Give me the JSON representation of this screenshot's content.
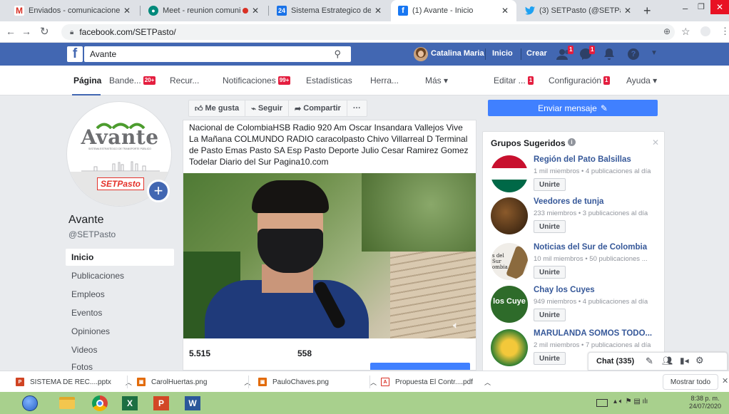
{
  "browser": {
    "tabs": [
      {
        "title": "Enviados - comunicaciones@av",
        "icon": "gmail-icon"
      },
      {
        "title": "Meet - reunion comunicac",
        "icon": "meet-icon"
      },
      {
        "title": "Sistema Estrategico de Transpor",
        "icon": "calendar-icon"
      },
      {
        "title": "(1) Avante - Inicio",
        "icon": "facebook-icon"
      },
      {
        "title": "(3) SETPasto (@SETPasto) / Twit",
        "icon": "twitter-icon"
      }
    ],
    "new_tab": "+",
    "url": "facebook.com/SETPasto/"
  },
  "fb_header": {
    "logo": "f",
    "search_value": "Avante",
    "user_name": "Catalina Maria",
    "nav": {
      "home": "Inicio",
      "create": "Crear"
    },
    "badges": {
      "friends": "1",
      "messages": "1"
    }
  },
  "subnav": {
    "items": [
      {
        "label": "Página",
        "active": true
      },
      {
        "label": "Bande...",
        "badge": "20+"
      },
      {
        "label": "Recur..."
      },
      {
        "label": "Notificaciones",
        "badge": "99+"
      },
      {
        "label": "Estadísticas"
      },
      {
        "label": "Herra..."
      },
      {
        "label": "Más ▾"
      },
      {
        "label": "Editar ...",
        "badge": "1"
      },
      {
        "label": "Configuración",
        "badge": "1"
      },
      {
        "label": "Ayuda ▾"
      }
    ]
  },
  "page": {
    "name": "Avante",
    "handle": "@SETPasto",
    "logo_text": "Avante",
    "logo_subtext": "SISTEMA ESTRATÉGICO DE TRANSPORTE PÚBLICO",
    "logo_tag": "SETPasto"
  },
  "sidebar": {
    "items": [
      {
        "label": "Inicio",
        "active": true
      },
      {
        "label": "Publicaciones"
      },
      {
        "label": "Empleos"
      },
      {
        "label": "Eventos"
      },
      {
        "label": "Opiniones"
      },
      {
        "label": "Videos"
      },
      {
        "label": "Fotos"
      }
    ]
  },
  "actions": {
    "like": "Me gusta",
    "follow": "Seguir",
    "share": "Compartir",
    "more": "···",
    "send_message": "Enviar mensaje"
  },
  "post": {
    "text": "Nacional de ColombiaHSB Radio 920 Am Oscar Insandara Vallejos Vive La Mañana COLMUNDO RADIO caracolpasto Chivo Villarreal D Terminal de Pasto Emas Pasto SA Esp Pasto Deporte Julio Cesar Ramirez Gomez Todelar Diario del Sur Pagina10.com",
    "stat1": "5.515",
    "stat2": "558"
  },
  "groups": {
    "title": "Grupos Sugeridos",
    "join_label": "Unirte",
    "items": [
      {
        "name": "Región del Pato Balsillas",
        "meta": "1 mil miembros • 4 publicaciones al día"
      },
      {
        "name": "Veedores de tunja",
        "meta": "233 miembros • 3 publicaciones al día"
      },
      {
        "name": "Noticias del Sur de Colombia",
        "meta": "10 mil miembros • 50 publicaciones ...",
        "thumb_text": "s del Sur ombia"
      },
      {
        "name": "Chay los Cuyes",
        "meta": "949 miembros • 4 publicaciones al día",
        "thumb_text": "los Cuye"
      },
      {
        "name": "MARULANDA SOMOS TODO...",
        "meta": "2 mil miembros • 7 publicaciones al día"
      }
    ]
  },
  "chat": {
    "label": "Chat (335)"
  },
  "downloads": {
    "items": [
      {
        "name": "SISTEMA DE REC....pptx"
      },
      {
        "name": "CarolHuertas.png"
      },
      {
        "name": "PauloChaves.png"
      },
      {
        "name": "Propuesta El Contr....pdf"
      }
    ],
    "show_all": "Mostrar todo"
  },
  "taskbar": {
    "time": "8:38 p. m.",
    "date": "24/07/2020"
  },
  "colors": {
    "fb_blue": "#4267b2",
    "link_blue": "#365899",
    "button_blue": "#4080ff",
    "badge_red": "#e41e3f",
    "taskbar": "#a8d08d"
  }
}
